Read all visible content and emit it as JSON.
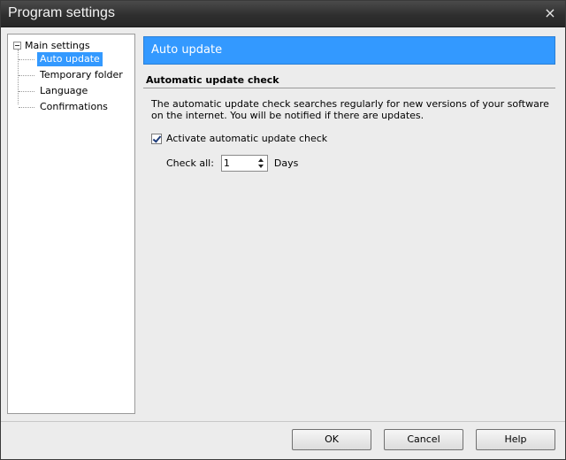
{
  "window": {
    "title": "Program settings",
    "close_glyph": "×"
  },
  "tree": {
    "root_label": "Main settings",
    "items": [
      {
        "label": "Auto update",
        "selected": true
      },
      {
        "label": "Temporary folder",
        "selected": false
      },
      {
        "label": "Language",
        "selected": false
      },
      {
        "label": "Confirmations",
        "selected": false
      }
    ]
  },
  "panel": {
    "header": "Auto update",
    "section_title": "Automatic update check",
    "description": "The automatic update check searches regularly for new versions of your software on the internet. You will be notified if there are updates.",
    "checkbox_label": "Activate automatic update check",
    "checkbox_checked": true,
    "check_all_label": "Check all:",
    "check_all_value": "1",
    "check_all_unit": "Days"
  },
  "buttons": {
    "ok": "OK",
    "cancel": "Cancel",
    "help": "Help"
  },
  "colors": {
    "accent": "#3399ff",
    "titlebar": "#2f2f2f"
  },
  "icons": {
    "close": "close-icon",
    "expander": "minus-box-icon",
    "checkbox": "checkmark-icon",
    "spin_up": "caret-up-icon",
    "spin_down": "caret-down-icon"
  }
}
